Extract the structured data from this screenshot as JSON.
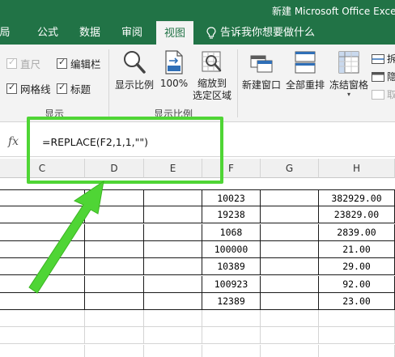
{
  "window": {
    "title": "新建 Microsoft Office Exce"
  },
  "tabs": [
    {
      "label": "局"
    },
    {
      "label": "公式"
    },
    {
      "label": "数据"
    },
    {
      "label": "审阅"
    },
    {
      "label": "视图"
    }
  ],
  "tell_me": {
    "label": "告诉我你想要做什么"
  },
  "ribbon": {
    "show_group": {
      "items": [
        {
          "label": "直尺",
          "checked": true,
          "enabled": false
        },
        {
          "label": "编辑栏",
          "checked": true,
          "enabled": true
        },
        {
          "label": "网格线",
          "checked": true,
          "enabled": true
        },
        {
          "label": "标题",
          "checked": true,
          "enabled": true
        }
      ],
      "group_label": "显示"
    },
    "zoom_group": {
      "zoom_label": "显示比例",
      "zoom100_label": "100%",
      "zoom_selection_label_1": "缩放到",
      "zoom_selection_label_2": "选定区域",
      "group_label": "显示比例"
    },
    "window_group": {
      "new_window_label": "新建窗口",
      "arrange_all_label": "全部重排",
      "freeze_label": "冻结窗格",
      "split_label": "拆",
      "hide_label": "隐",
      "unhide_label": "取"
    }
  },
  "formula_bar": {
    "fx_label": "fx",
    "formula": "=REPLACE(F2,1,1,\"\")"
  },
  "columns": [
    "C",
    "D",
    "E",
    "F",
    "G",
    "H"
  ],
  "rows": [
    {
      "F": "10023",
      "H": "382929.00"
    },
    {
      "F": "19238",
      "H": "23829.00"
    },
    {
      "F": "1068",
      "H": "2839.00"
    },
    {
      "F": "100000",
      "H": "21.00"
    },
    {
      "F": "10389",
      "H": "29.00"
    },
    {
      "F": "100923",
      "H": "92.00"
    },
    {
      "F": "12389",
      "H": "23.00"
    }
  ],
  "colors": {
    "accent": "#217346",
    "highlight": "#4fd535"
  }
}
